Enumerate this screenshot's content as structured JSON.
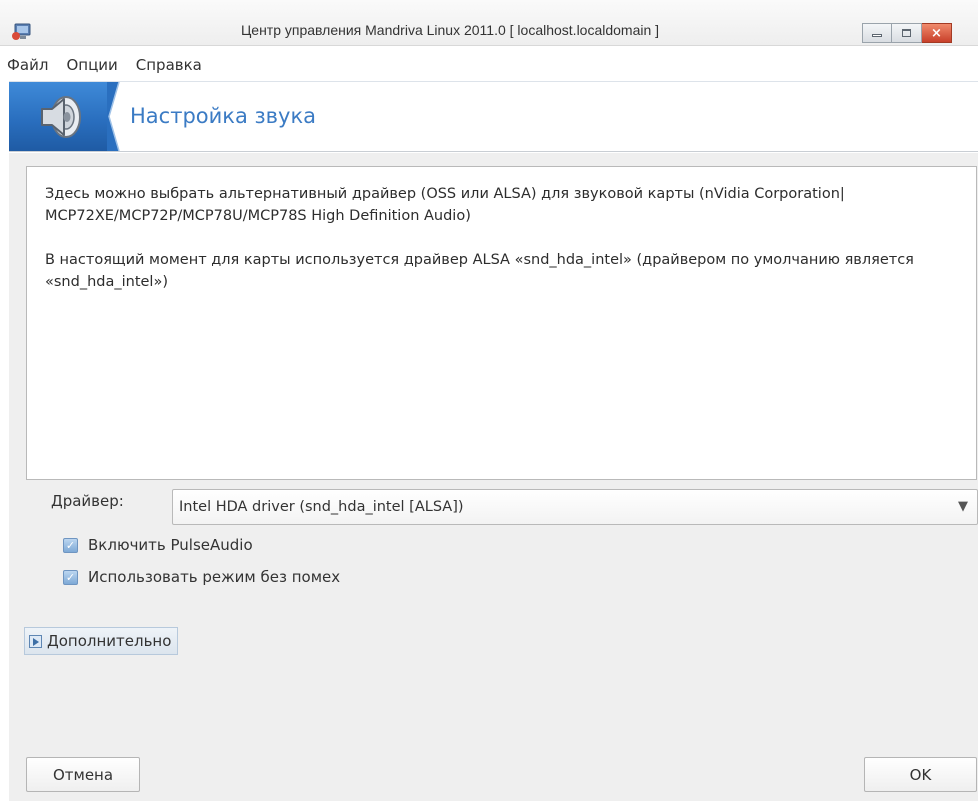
{
  "window": {
    "title": "Центр управления Mandriva Linux 2011.0 [ localhost.localdomain ]",
    "app_icon": "mandriva-app-icon",
    "controls": [
      "minimize-icon",
      "maximize-icon",
      "close-icon"
    ],
    "close_glyph": "×"
  },
  "menu": {
    "items": [
      {
        "label": "Файл"
      },
      {
        "label": "Опции"
      },
      {
        "label": "Справка"
      }
    ]
  },
  "banner": {
    "icon": "speaker-icon",
    "title": "Настройка звука",
    "accent_color": "#3b7bc4"
  },
  "info": {
    "paragraph1": "Здесь можно выбрать альтернативный драйвер (OSS или ALSA) для звуковой карты (nVidia Corporation| MCP72XE/MCP72P/MCP78U/MCP78S High Definition Audio)",
    "paragraph2": "В настоящий момент для карты используется драйвер ALSA «snd_hda_intel» (драйвером по умолчанию является «snd_hda_intel»)"
  },
  "driver": {
    "label": "Драйвер:",
    "selected": "Intel HDA driver (snd_hda_intel [ALSA])",
    "arrow": "▼"
  },
  "options": [
    {
      "label": "Включить PulseAudio",
      "checked": true
    },
    {
      "label": "Использовать режим без помех",
      "checked": true
    }
  ],
  "check_glyph": "✓",
  "advanced": {
    "label": "Дополнительно",
    "icon": "expander-right-icon"
  },
  "buttons": {
    "cancel": "Отмена",
    "ok": "OK"
  }
}
